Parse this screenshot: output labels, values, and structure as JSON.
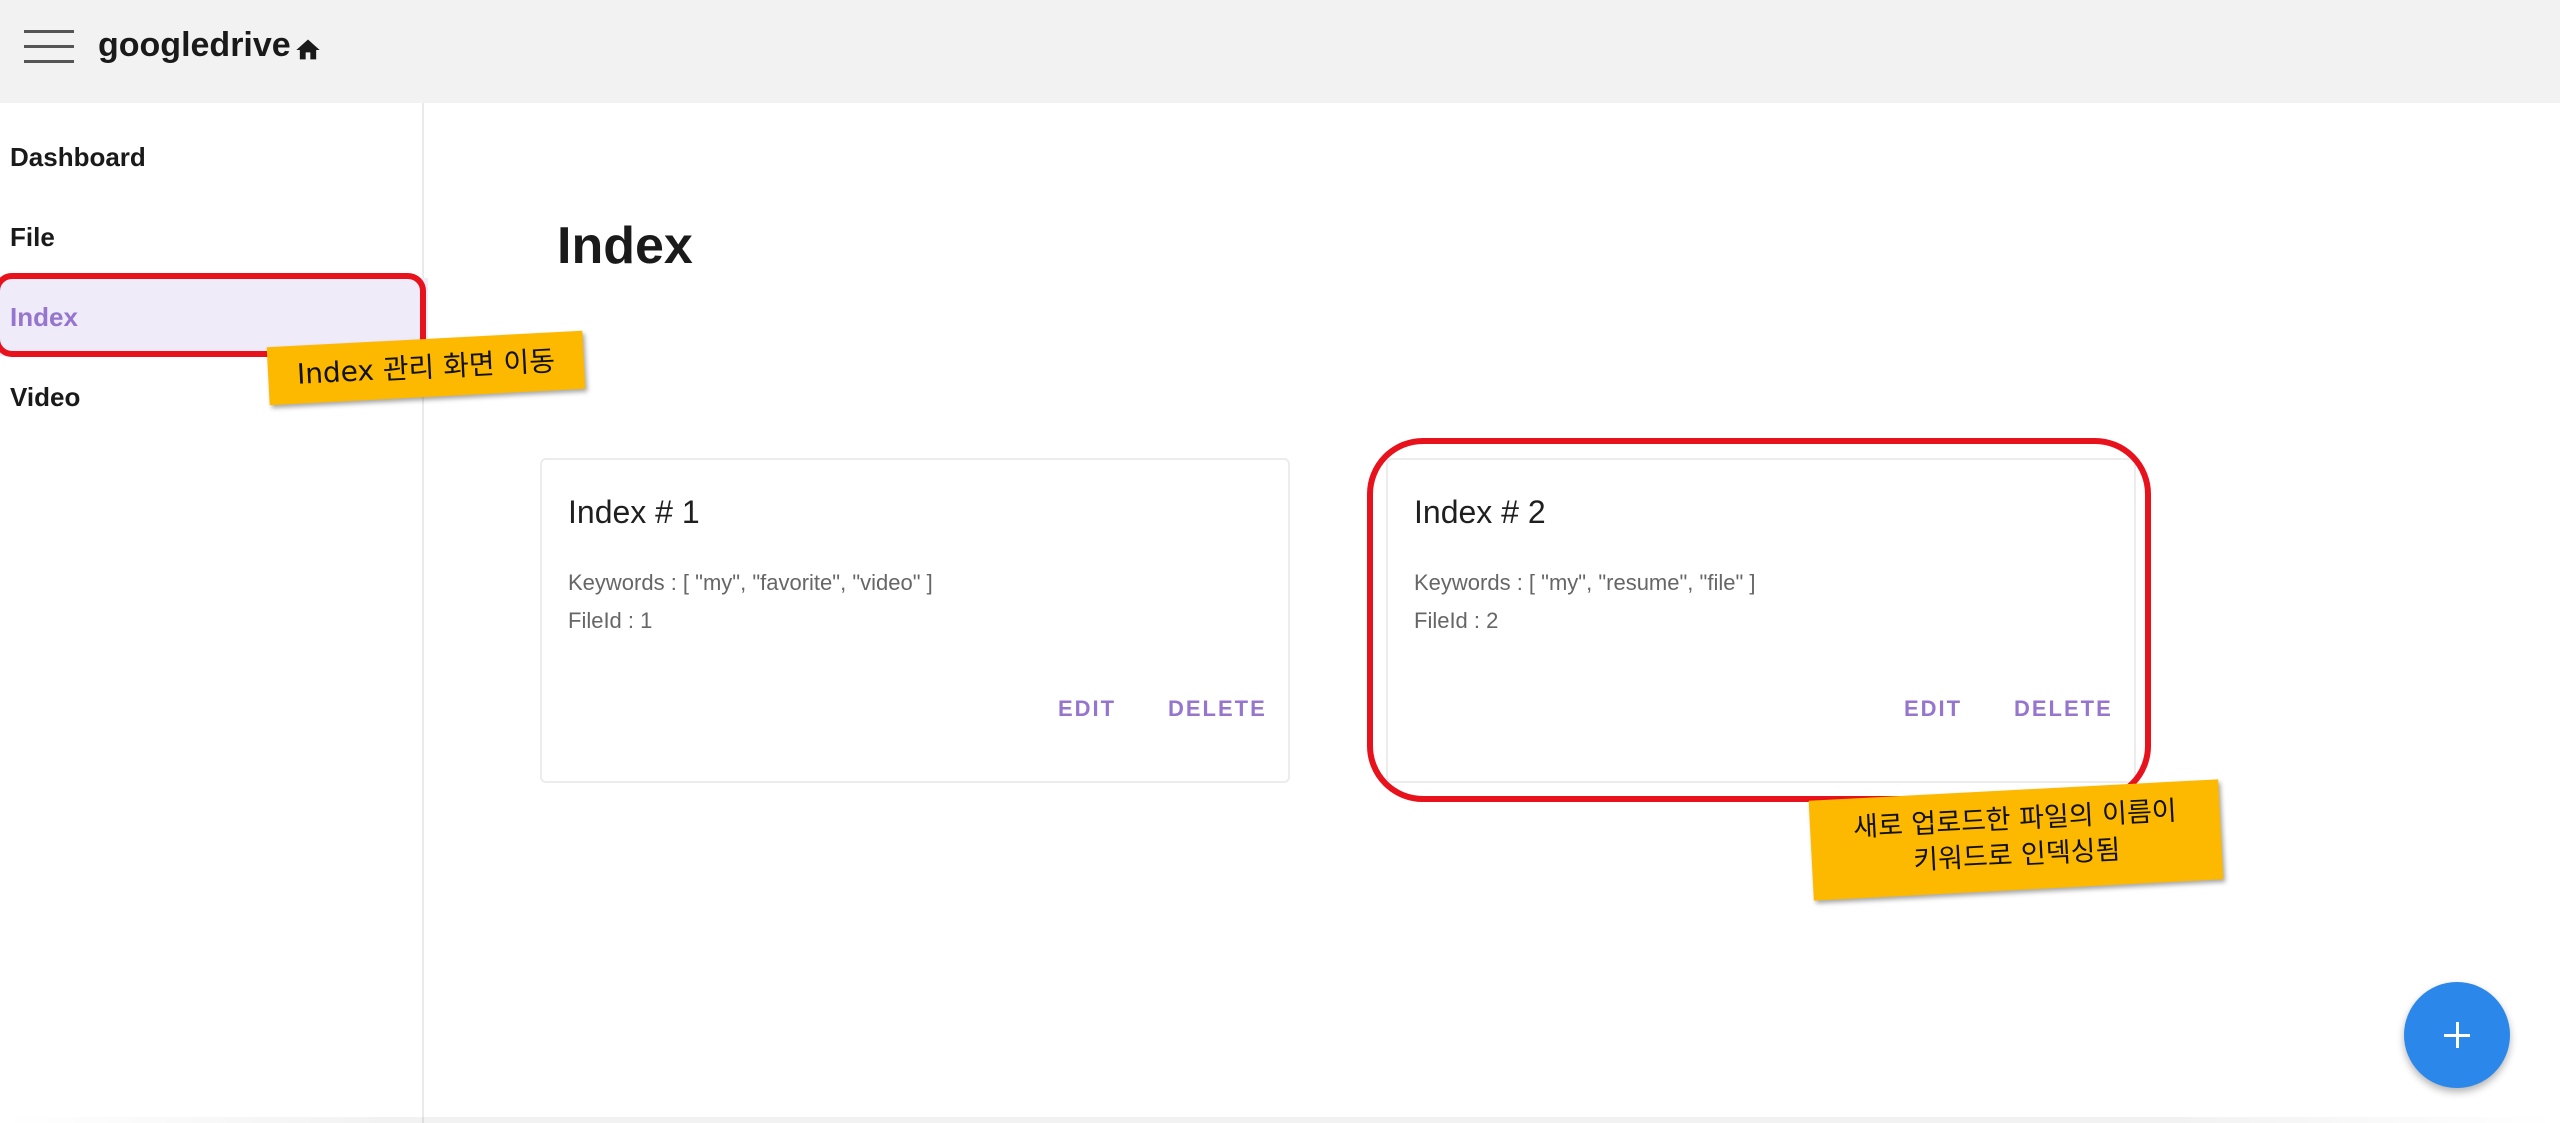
{
  "app": {
    "title": "googledrive"
  },
  "sidebar": {
    "items": [
      {
        "label": "Dashboard"
      },
      {
        "label": "File"
      },
      {
        "label": "Index"
      },
      {
        "label": "Video"
      }
    ],
    "active": "Index"
  },
  "page": {
    "title": "Index"
  },
  "cards": [
    {
      "title": "Index # 1",
      "keywords": "Keywords : [ \"my\", \"favorite\", \"video\" ]",
      "file_id": "FileId : 1",
      "edit_label": "EDIT",
      "delete_label": "DELETE"
    },
    {
      "title": "Index # 2",
      "keywords": "Keywords : [ \"my\", \"resume\", \"file\" ]",
      "file_id": "FileId : 2",
      "edit_label": "EDIT",
      "delete_label": "DELETE"
    }
  ],
  "annotations": {
    "nav_callout": "Index 관리 화면 이동",
    "card_callout_line1": "새로 업로드한 파일의 이름이",
    "card_callout_line2": "키워드로 인덱싱됨"
  },
  "fab": {
    "icon": "plus-icon"
  },
  "icons": {
    "menu": "hamburger-menu-icon",
    "home": "home-icon"
  },
  "colors": {
    "accent": "#9575cd",
    "active_bg": "#efebf9",
    "fab": "#2b87e9",
    "highlight": "#e8121c",
    "callout": "#fcb900",
    "appbar": "#f2f2f2"
  }
}
